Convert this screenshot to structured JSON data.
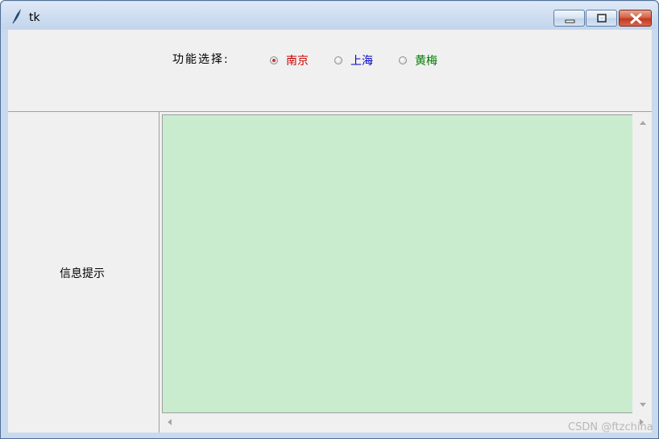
{
  "window": {
    "title": "tk",
    "icon": "feather-icon"
  },
  "controls": {
    "label": "功能选择:",
    "options": [
      {
        "label": "南京",
        "color": "#cc0000",
        "checked": true
      },
      {
        "label": "上海",
        "color": "#0000cc",
        "checked": false
      },
      {
        "label": "黄梅",
        "color": "#007a00",
        "checked": false
      }
    ]
  },
  "panel": {
    "info_label": "信息提示"
  },
  "text_area": {
    "value": "",
    "background": "#c9ecce"
  },
  "watermark": "CSDN @ftzchina"
}
